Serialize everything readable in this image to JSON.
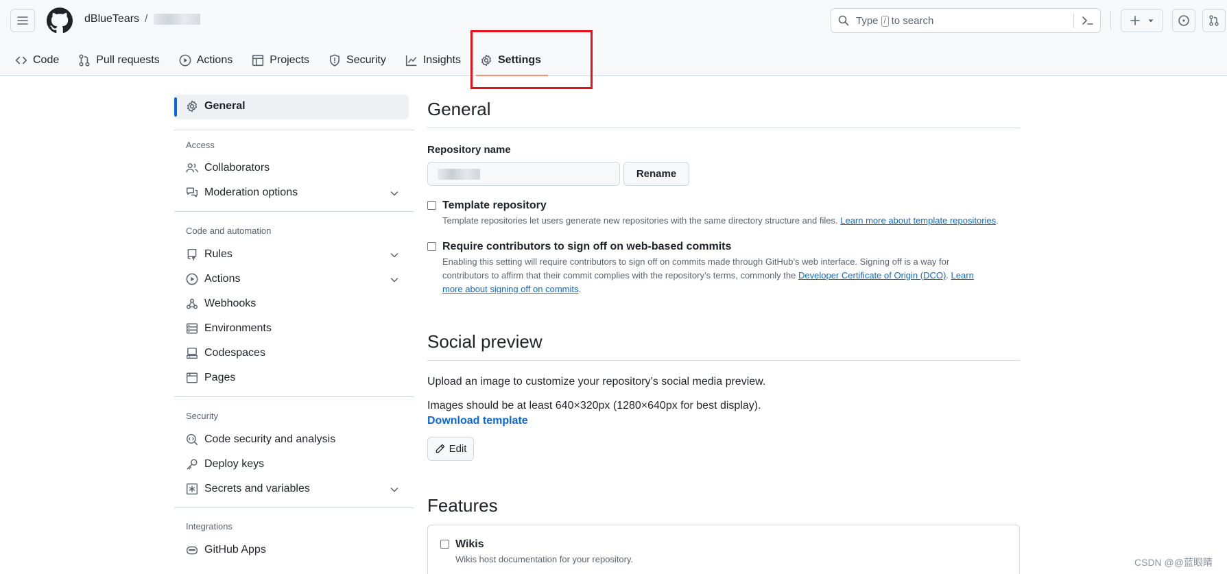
{
  "header": {
    "owner": "dBlueTears",
    "separator": "/",
    "search": {
      "prefix": "Type",
      "key": "/",
      "suffix": "to search"
    }
  },
  "tabs": [
    {
      "label": "Code",
      "icon": "code-icon"
    },
    {
      "label": "Pull requests",
      "icon": "git-pull-request-icon"
    },
    {
      "label": "Actions",
      "icon": "play-icon"
    },
    {
      "label": "Projects",
      "icon": "table-icon"
    },
    {
      "label": "Security",
      "icon": "shield-icon"
    },
    {
      "label": "Insights",
      "icon": "graph-icon"
    },
    {
      "label": "Settings",
      "icon": "gear-icon",
      "active": true
    }
  ],
  "sidebar": {
    "general": "General",
    "access_heading": "Access",
    "access": [
      {
        "label": "Collaborators",
        "icon": "people-icon"
      },
      {
        "label": "Moderation options",
        "icon": "comment-discussion-icon",
        "expandable": true
      }
    ],
    "code_heading": "Code and automation",
    "code": [
      {
        "label": "Rules",
        "icon": "repo-push-icon",
        "expandable": true
      },
      {
        "label": "Actions",
        "icon": "play-icon",
        "expandable": true
      },
      {
        "label": "Webhooks",
        "icon": "webhook-icon"
      },
      {
        "label": "Environments",
        "icon": "server-icon"
      },
      {
        "label": "Codespaces",
        "icon": "codespaces-icon"
      },
      {
        "label": "Pages",
        "icon": "browser-icon"
      }
    ],
    "security_heading": "Security",
    "security": [
      {
        "label": "Code security and analysis",
        "icon": "codescan-icon"
      },
      {
        "label": "Deploy keys",
        "icon": "key-icon"
      },
      {
        "label": "Secrets and variables",
        "icon": "key-asterisk-icon",
        "expandable": true
      }
    ],
    "integrations_heading": "Integrations",
    "integrations": [
      {
        "label": "GitHub Apps",
        "icon": "hubot-icon"
      }
    ]
  },
  "main": {
    "general_title": "General",
    "repo_name_label": "Repository name",
    "rename_button": "Rename",
    "template": {
      "title": "Template repository",
      "desc": "Template repositories let users generate new repositories with the same directory structure and files.",
      "link": "Learn more about template repositories",
      "end": "."
    },
    "signoff": {
      "title": "Require contributors to sign off on web-based commits",
      "line1": "Enabling this setting will require contributors to sign off on commits made through GitHub’s web interface. Signing off is a way for",
      "line2a": "contributors to affirm that their commit complies with the repository’s terms, commonly the",
      "link1": "Developer Certificate of Origin (DCO)",
      "mid": ".",
      "link2a": "Learn",
      "link2b": "more about signing off on commits",
      "end": "."
    },
    "social_title": "Social preview",
    "social_p1": "Upload an image to customize your repository’s social media preview.",
    "social_p2": "Images should be at least 640×320px (1280×640px for best display).",
    "download_template": "Download template",
    "edit_button": "Edit",
    "features_title": "Features",
    "wikis": {
      "title": "Wikis",
      "desc": "Wikis host documentation for your repository."
    }
  },
  "watermark": "CSDN @@蓝眼睛"
}
